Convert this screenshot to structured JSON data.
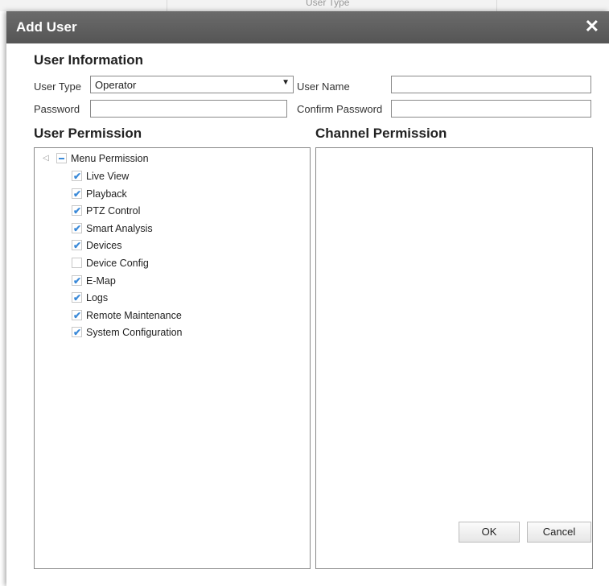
{
  "background": {
    "column_header": "User Type"
  },
  "dialog": {
    "title": "Add User"
  },
  "user_info": {
    "title": "User Information",
    "user_type_label": "User Type",
    "user_type_value": "Operator",
    "user_name_label": "User Name",
    "user_name_value": "",
    "password_label": "Password",
    "password_value": "",
    "confirm_password_label": "Confirm Password",
    "confirm_password_value": ""
  },
  "user_permission": {
    "title": "User Permission",
    "root": {
      "label": "Menu Permission",
      "state": "partial"
    },
    "items": [
      {
        "label": "Live View",
        "checked": true
      },
      {
        "label": "Playback",
        "checked": true
      },
      {
        "label": "PTZ Control",
        "checked": true
      },
      {
        "label": "Smart Analysis",
        "checked": true
      },
      {
        "label": "Devices",
        "checked": true
      },
      {
        "label": "Device Config",
        "checked": false
      },
      {
        "label": "E-Map",
        "checked": true
      },
      {
        "label": "Logs",
        "checked": true
      },
      {
        "label": "Remote Maintenance",
        "checked": true
      },
      {
        "label": "System Configuration",
        "checked": true
      }
    ]
  },
  "channel_permission": {
    "title": "Channel Permission"
  },
  "buttons": {
    "ok": "OK",
    "cancel": "Cancel"
  },
  "colors": {
    "titlebar": "#5e5e5e",
    "checkmark": "#3b8ad8"
  }
}
